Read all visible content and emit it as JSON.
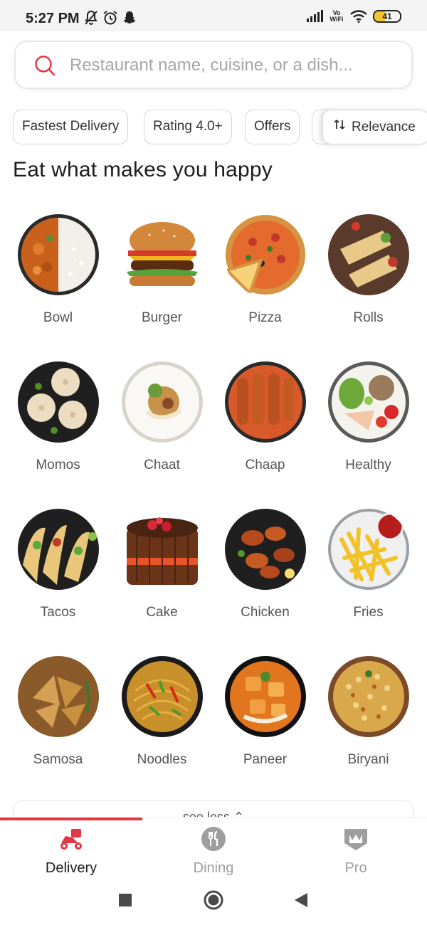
{
  "status_bar": {
    "time": "5:27 PM",
    "battery": "41",
    "battery_level": 0.41,
    "network_label": "Vo WiFi",
    "icons_left": [
      "mute-icon",
      "alarm-icon",
      "snapchat-icon"
    ],
    "icons_right": [
      "signal-icon",
      "vowifi-icon",
      "wifi-icon",
      "battery-icon"
    ]
  },
  "search": {
    "placeholder": "Restaurant name, cuisine, or a dish...",
    "value": ""
  },
  "filters": {
    "chips": [
      "Fastest Delivery",
      "Rating 4.0+",
      "Offers"
    ],
    "sort_label": "Relevance"
  },
  "section": {
    "title": "Eat what makes you happy"
  },
  "categories": [
    {
      "label": "Bowl",
      "icon": "bowl-image"
    },
    {
      "label": "Burger",
      "icon": "burger-image"
    },
    {
      "label": "Pizza",
      "icon": "pizza-image"
    },
    {
      "label": "Rolls",
      "icon": "rolls-image"
    },
    {
      "label": "Momos",
      "icon": "momos-image"
    },
    {
      "label": "Chaat",
      "icon": "chaat-image"
    },
    {
      "label": "Chaap",
      "icon": "chaap-image"
    },
    {
      "label": "Healthy",
      "icon": "healthy-image"
    },
    {
      "label": "Tacos",
      "icon": "tacos-image"
    },
    {
      "label": "Cake",
      "icon": "cake-image"
    },
    {
      "label": "Chicken",
      "icon": "chicken-image"
    },
    {
      "label": "Fries",
      "icon": "fries-image"
    },
    {
      "label": "Samosa",
      "icon": "samosa-image"
    },
    {
      "label": "Noodles",
      "icon": "noodles-image"
    },
    {
      "label": "Paneer",
      "icon": "paneer-image"
    },
    {
      "label": "Biryani",
      "icon": "biryani-image"
    }
  ],
  "see_less": {
    "label": "see less"
  },
  "bottom_nav": {
    "items": [
      {
        "label": "Delivery",
        "icon": "scooter-icon",
        "active": true
      },
      {
        "label": "Dining",
        "icon": "cutlery-icon",
        "active": false
      },
      {
        "label": "Pro",
        "icon": "crown-icon",
        "active": false
      }
    ],
    "active_color": "#e23744",
    "inactive_color": "#9e9e9e"
  },
  "system_nav": [
    "recents-icon",
    "home-icon",
    "back-icon"
  ],
  "colors": {
    "accent": "#e23744",
    "text_primary": "#1c1c1c",
    "text_secondary": "#555555",
    "placeholder": "#a6a6a6"
  }
}
